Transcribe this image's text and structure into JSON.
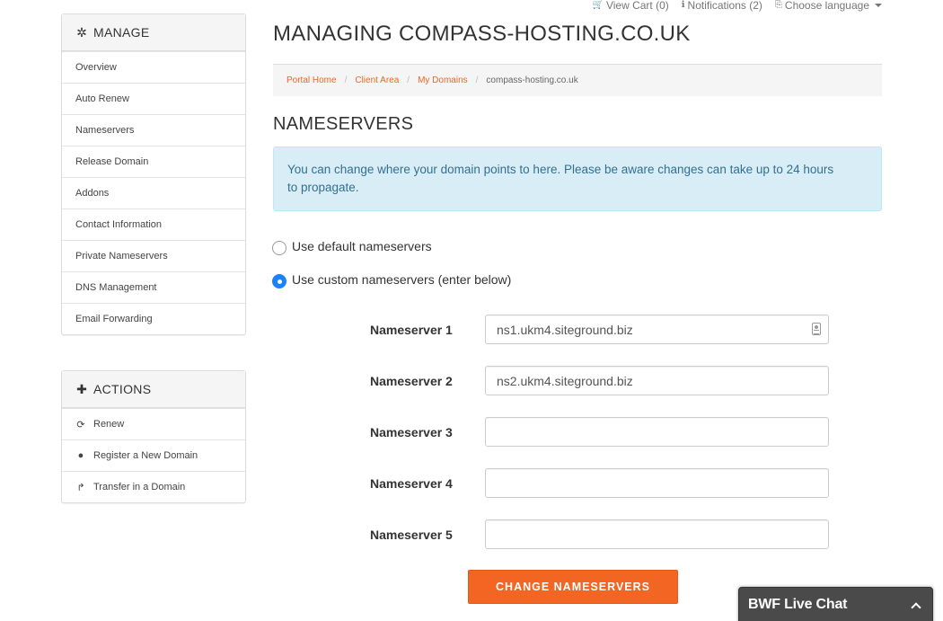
{
  "topbar": {
    "view_cart": "View Cart (0)",
    "notifications": "Notifications (2)",
    "choose_language": "Choose language"
  },
  "sidebar": {
    "manage": {
      "title": "MANAGE",
      "items": [
        {
          "label": "Overview"
        },
        {
          "label": "Auto Renew"
        },
        {
          "label": "Nameservers"
        },
        {
          "label": "Release Domain"
        },
        {
          "label": "Addons"
        },
        {
          "label": "Contact Information"
        },
        {
          "label": "Private Nameservers"
        },
        {
          "label": "DNS Management"
        },
        {
          "label": "Email Forwarding"
        }
      ]
    },
    "actions": {
      "title": "ACTIONS",
      "items": [
        {
          "label": "Renew",
          "icon": "refresh-icon"
        },
        {
          "label": "Register a New Domain",
          "icon": "globe-icon"
        },
        {
          "label": "Transfer in a Domain",
          "icon": "share-icon"
        }
      ]
    }
  },
  "main": {
    "page_title": "MANAGING COMPASS-HOSTING.CO.UK",
    "breadcrumb": [
      "Portal Home",
      "Client Area",
      "My Domains",
      "compass-hosting.co.uk"
    ],
    "section_title": "NAMESERVERS",
    "alert": "You can change where your domain points to here. Please be aware changes can take up to 24 hours to propagate.",
    "radio_default": "Use default nameservers",
    "radio_custom": "Use custom nameservers (enter below)",
    "selected_option": "custom",
    "nameservers": [
      {
        "label": "Nameserver 1",
        "value": "ns1.ukm4.siteground.biz"
      },
      {
        "label": "Nameserver 2",
        "value": "ns2.ukm4.siteground.biz"
      },
      {
        "label": "Nameserver 3",
        "value": ""
      },
      {
        "label": "Nameserver 4",
        "value": ""
      },
      {
        "label": "Nameserver 5",
        "value": ""
      }
    ],
    "submit_label": "CHANGE NAMESERVERS"
  },
  "livechat": {
    "title": "BWF Live Chat"
  },
  "colors": {
    "accent": "#f26522",
    "alert_bg": "#d9edf7",
    "alert_text": "#31708f",
    "radio_selected": "#1a82fb"
  }
}
